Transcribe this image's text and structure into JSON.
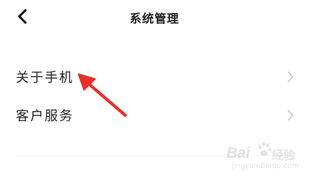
{
  "header": {
    "title": "系统管理",
    "back_icon": "chevron-left-icon"
  },
  "menu": {
    "items": [
      {
        "label": "关于手机",
        "icon": "chevron-right-icon"
      },
      {
        "label": "客户服务",
        "icon": "chevron-right-icon"
      }
    ]
  },
  "annotation": {
    "arrow_color": "#e8302b"
  },
  "watermark": {
    "brand": "Bai",
    "brand_cn": "经验",
    "url": "jingyan.baidu.com"
  },
  "colors": {
    "text": "#222222",
    "chevron": "#c8c8c8",
    "background": "#ffffff"
  }
}
